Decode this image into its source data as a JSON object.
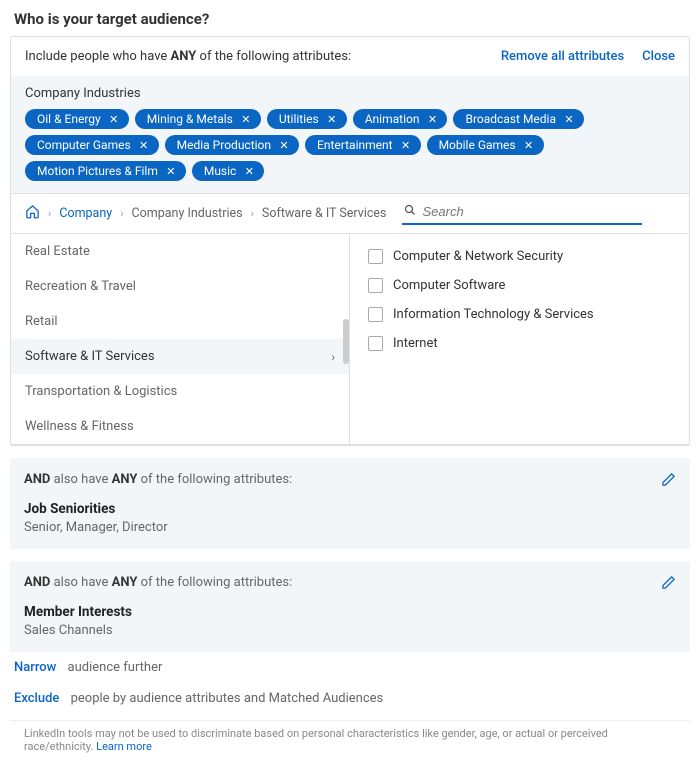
{
  "title": "Who is your target audience?",
  "top": {
    "include_text_pre": "Include people who have ",
    "include_bold": "ANY",
    "include_text_post": " of the following attributes:",
    "remove_all": "Remove all attributes",
    "close": "Close"
  },
  "industries": {
    "label": "Company Industries",
    "pills": [
      "Oil & Energy",
      "Mining & Metals",
      "Utilities",
      "Animation",
      "Broadcast Media",
      "Computer Games",
      "Media Production",
      "Entertainment",
      "Mobile Games",
      "Motion Pictures & Film",
      "Music"
    ]
  },
  "breadcrumb": {
    "items": [
      "Company",
      "Company Industries",
      "Software & IT Services"
    ],
    "search_placeholder": "Search"
  },
  "left_categories": [
    {
      "label": "Real Estate",
      "active": false
    },
    {
      "label": "Recreation & Travel",
      "active": false
    },
    {
      "label": "Retail",
      "active": false
    },
    {
      "label": "Software & IT Services",
      "active": true
    },
    {
      "label": "Transportation & Logistics",
      "active": false
    },
    {
      "label": "Wellness & Fitness",
      "active": false
    }
  ],
  "right_options": [
    "Computer & Network Security",
    "Computer Software",
    "Information Technology & Services",
    "Internet"
  ],
  "blocks": [
    {
      "and": "AND",
      "pre": " also have ",
      "bold": "ANY",
      "post": " of the following attributes:",
      "title": "Job Seniorities",
      "sub": "Senior, Manager, Director"
    },
    {
      "and": "AND",
      "pre": " also have ",
      "bold": "ANY",
      "post": " of the following attributes:",
      "title": "Member Interests",
      "sub": "Sales Channels"
    }
  ],
  "footer": {
    "narrow_lead": "Narrow",
    "narrow_rest": "audience further",
    "exclude_lead": "Exclude",
    "exclude_rest": "people by audience attributes and Matched Audiences"
  },
  "disclaimer": {
    "text": "LinkedIn tools may not be used to discriminate based on personal characteristics like gender, age, or actual or perceived race/ethnicity. ",
    "learn": "Learn more"
  }
}
